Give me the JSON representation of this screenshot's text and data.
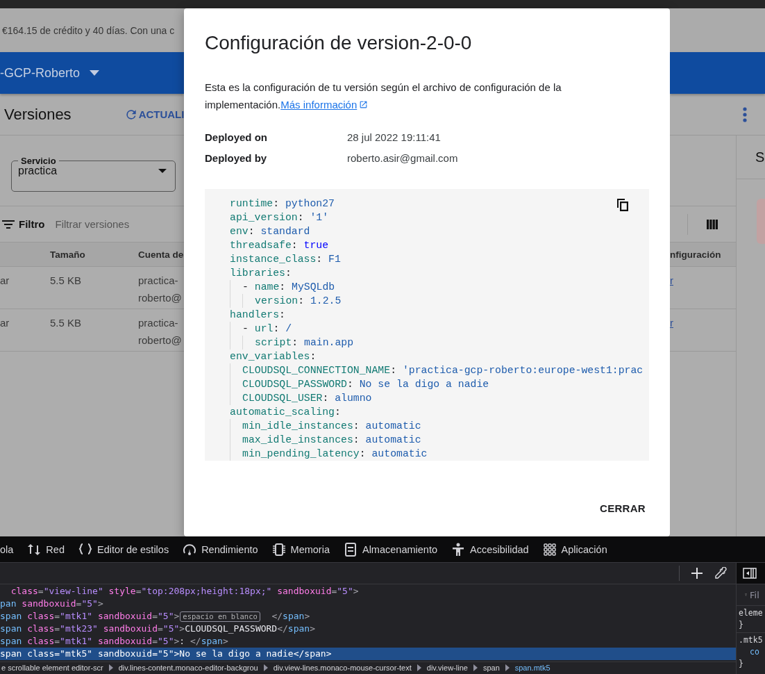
{
  "background": {
    "banner": {
      "text": "€164.15 de crédito y 40 días. Con una c"
    },
    "project_bar": {
      "project": "-GCP-Roberto"
    },
    "header": {
      "title": "Versiones",
      "refresh": "ACTUALI"
    },
    "service_select": {
      "label": "Servicio",
      "value": "practica"
    },
    "filter": {
      "label": "Filtro",
      "placeholder": "Filtrar versiones"
    },
    "table": {
      "columns": [
        "Tamaño",
        "Cuenta de",
        "nfiguración"
      ],
      "rows": [
        {
          "column_1": "ar",
          "tamano": "5.5 KB",
          "cuenta_de": [
            "practica-",
            "roberto@"
          ],
          "configuracion": "r"
        },
        {
          "column_1": "ar",
          "tamano": "5.5 KB",
          "cuenta_de": [
            "practica-",
            "roberto@"
          ],
          "configuracion": "r"
        }
      ]
    },
    "side_panel": {
      "title": "S"
    }
  },
  "dialog": {
    "title": "Configuración de version-2-0-0",
    "description": "Esta es la configuración de tu versión según el archivo de configuración de la implementación.",
    "link": "Más información",
    "details": [
      {
        "label": "Deployed on",
        "value": "28 jul 2022 19:11:41"
      },
      {
        "label": "Deployed by",
        "value": "roberto.asir@gmail.com"
      }
    ],
    "config": [
      {
        "key": "runtime",
        "sep": ":",
        "value": "python27",
        "kind": "scalar"
      },
      {
        "key": "api_version",
        "sep": ":",
        "value": "'1'",
        "kind": "scalar"
      },
      {
        "key": "env",
        "sep": ":",
        "value": "standard",
        "kind": "scalar"
      },
      {
        "key": "threadsafe",
        "sep": ":",
        "value": "true",
        "kind": "boolean"
      },
      {
        "key": "instance_class",
        "sep": ":",
        "value": "F1",
        "kind": "scalar"
      },
      {
        "key": "libraries",
        "sep": ":",
        "kind": "map",
        "children": [
          {
            "bullet": "-",
            "key": "name",
            "sep": ":",
            "value": "MySQLdb",
            "kind": "scalar",
            "children": [
              {
                "key": "version",
                "sep": ":",
                "value": "1.2.5",
                "kind": "scalar"
              }
            ]
          }
        ]
      },
      {
        "key": "handlers",
        "sep": ":",
        "kind": "map",
        "children": [
          {
            "bullet": "-",
            "key": "url",
            "sep": ":",
            "value": "/",
            "kind": "scalar",
            "children": [
              {
                "key": "script",
                "sep": ":",
                "value": "main.app",
                "kind": "scalar"
              }
            ]
          }
        ]
      },
      {
        "key": "env_variables",
        "sep": ":",
        "kind": "map",
        "children": [
          {
            "key": "CLOUDSQL_CONNECTION_NAME",
            "sep": ":",
            "value": "'practica-gcp-roberto:europe-west1:prac",
            "kind": "scalar"
          },
          {
            "key": "CLOUDSQL_PASSWORD",
            "sep": ":",
            "value": "No se la digo a nadie",
            "kind": "scalar"
          },
          {
            "key": "CLOUDSQL_USER",
            "sep": ":",
            "value": "alumno",
            "kind": "scalar"
          }
        ]
      },
      {
        "key": "automatic_scaling",
        "sep": ":",
        "kind": "map",
        "children": [
          {
            "key": "min_idle_instances",
            "sep": ":",
            "value": "automatic",
            "kind": "scalar"
          },
          {
            "key": "max_idle_instances",
            "sep": ":",
            "value": "automatic",
            "kind": "scalar"
          },
          {
            "key": "min_pending_latency",
            "sep": ":",
            "value": "automatic",
            "kind": "scalar"
          }
        ]
      }
    ],
    "close_button": "CERRAR"
  },
  "devtools": {
    "tabs": [
      {
        "label": "ola"
      },
      {
        "label": "Red"
      },
      {
        "label": "Editor de estilos"
      },
      {
        "label": "Rendimiento"
      },
      {
        "label": "Memoria"
      },
      {
        "label": "Almacenamiento"
      },
      {
        "label": "Accesibilidad"
      },
      {
        "label": "Aplicación"
      }
    ],
    "markup_lines": [
      {
        "selected": false,
        "segments": [
          {
            "kind": "attr",
            "text": "  class"
          },
          {
            "kind": "punct",
            "text": "="
          },
          {
            "kind": "value",
            "text": "\"view-line\""
          },
          {
            "kind": "attr",
            "text": " style"
          },
          {
            "kind": "punct",
            "text": "="
          },
          {
            "kind": "value",
            "text": "\"top:208px;height:18px;\""
          },
          {
            "kind": "attr",
            "text": " sandboxuid"
          },
          {
            "kind": "punct",
            "text": "="
          },
          {
            "kind": "value",
            "text": "\"5\""
          },
          {
            "kind": "punct",
            "text": ">"
          }
        ]
      },
      {
        "selected": false,
        "segments": [
          {
            "kind": "tag",
            "text": "pan"
          },
          {
            "kind": "attr",
            "text": " sandboxuid"
          },
          {
            "kind": "punct",
            "text": "="
          },
          {
            "kind": "value",
            "text": "\"5\""
          },
          {
            "kind": "punct",
            "text": ">"
          }
        ]
      },
      {
        "selected": false,
        "segments": [
          {
            "kind": "tag",
            "text": "span"
          },
          {
            "kind": "attr",
            "text": " class"
          },
          {
            "kind": "punct",
            "text": "="
          },
          {
            "kind": "value",
            "text": "\"mtk1\""
          },
          {
            "kind": "attr",
            "text": " sandboxuid"
          },
          {
            "kind": "punct",
            "text": "="
          },
          {
            "kind": "value",
            "text": "\"5\""
          },
          {
            "kind": "punct",
            "text": ">"
          },
          {
            "kind": "badge",
            "text": "espacio en blanco"
          },
          {
            "kind": "punct",
            "text": "  </"
          },
          {
            "kind": "tag",
            "text": "span"
          },
          {
            "kind": "punct",
            "text": ">"
          }
        ]
      },
      {
        "selected": false,
        "segments": [
          {
            "kind": "tag",
            "text": "span"
          },
          {
            "kind": "attr",
            "text": " class"
          },
          {
            "kind": "punct",
            "text": "="
          },
          {
            "kind": "value",
            "text": "\"mtk23\""
          },
          {
            "kind": "attr",
            "text": " sandboxuid"
          },
          {
            "kind": "punct",
            "text": "="
          },
          {
            "kind": "value",
            "text": "\"5\""
          },
          {
            "kind": "punct",
            "text": ">"
          },
          {
            "kind": "text",
            "text": "CLOUDSQL_PASSWORD"
          },
          {
            "kind": "punct",
            "text": "</"
          },
          {
            "kind": "tag",
            "text": "span"
          },
          {
            "kind": "punct",
            "text": ">"
          }
        ]
      },
      {
        "selected": false,
        "segments": [
          {
            "kind": "tag",
            "text": "span"
          },
          {
            "kind": "attr",
            "text": " class"
          },
          {
            "kind": "punct",
            "text": "="
          },
          {
            "kind": "value",
            "text": "\"mtk1\""
          },
          {
            "kind": "attr",
            "text": " sandboxuid"
          },
          {
            "kind": "punct",
            "text": "="
          },
          {
            "kind": "value",
            "text": "\"5\""
          },
          {
            "kind": "punct",
            "text": ">"
          },
          {
            "kind": "text",
            "text": ": "
          },
          {
            "kind": "punct",
            "text": "</"
          },
          {
            "kind": "tag",
            "text": "span"
          },
          {
            "kind": "punct",
            "text": ">"
          }
        ]
      },
      {
        "selected": true,
        "segments": [
          {
            "kind": "tag",
            "text": "span"
          },
          {
            "kind": "attr",
            "text": " class"
          },
          {
            "kind": "punct",
            "text": "="
          },
          {
            "kind": "value",
            "text": "\"mtk5\""
          },
          {
            "kind": "attr",
            "text": " sandboxuid"
          },
          {
            "kind": "punct",
            "text": "="
          },
          {
            "kind": "value",
            "text": "\"5\""
          },
          {
            "kind": "punct",
            "text": ">"
          },
          {
            "kind": "text",
            "text": "No se la digo a nadie"
          },
          {
            "kind": "punct",
            "text": "</"
          },
          {
            "kind": "tag",
            "text": "span"
          },
          {
            "kind": "punct",
            "text": ">"
          }
        ]
      }
    ],
    "breadcrumbs": [
      "e scrollable element editor-scr",
      "div.lines-content.monaco-editor-backgrou",
      "div.view-lines.monaco-mouse-cursor-text",
      "div.view-line",
      "span",
      "span.mtk5"
    ],
    "rules_panel": {
      "filter_placeholder": "Fil",
      "lines": [
        {
          "kind": "selector",
          "text": "eleme"
        },
        {
          "kind": "brace",
          "text": "}"
        },
        {
          "kind": "selector",
          "text": ".mtk5"
        },
        {
          "kind": "declaration",
          "text": "co"
        },
        {
          "kind": "brace",
          "text": "}"
        }
      ]
    }
  }
}
